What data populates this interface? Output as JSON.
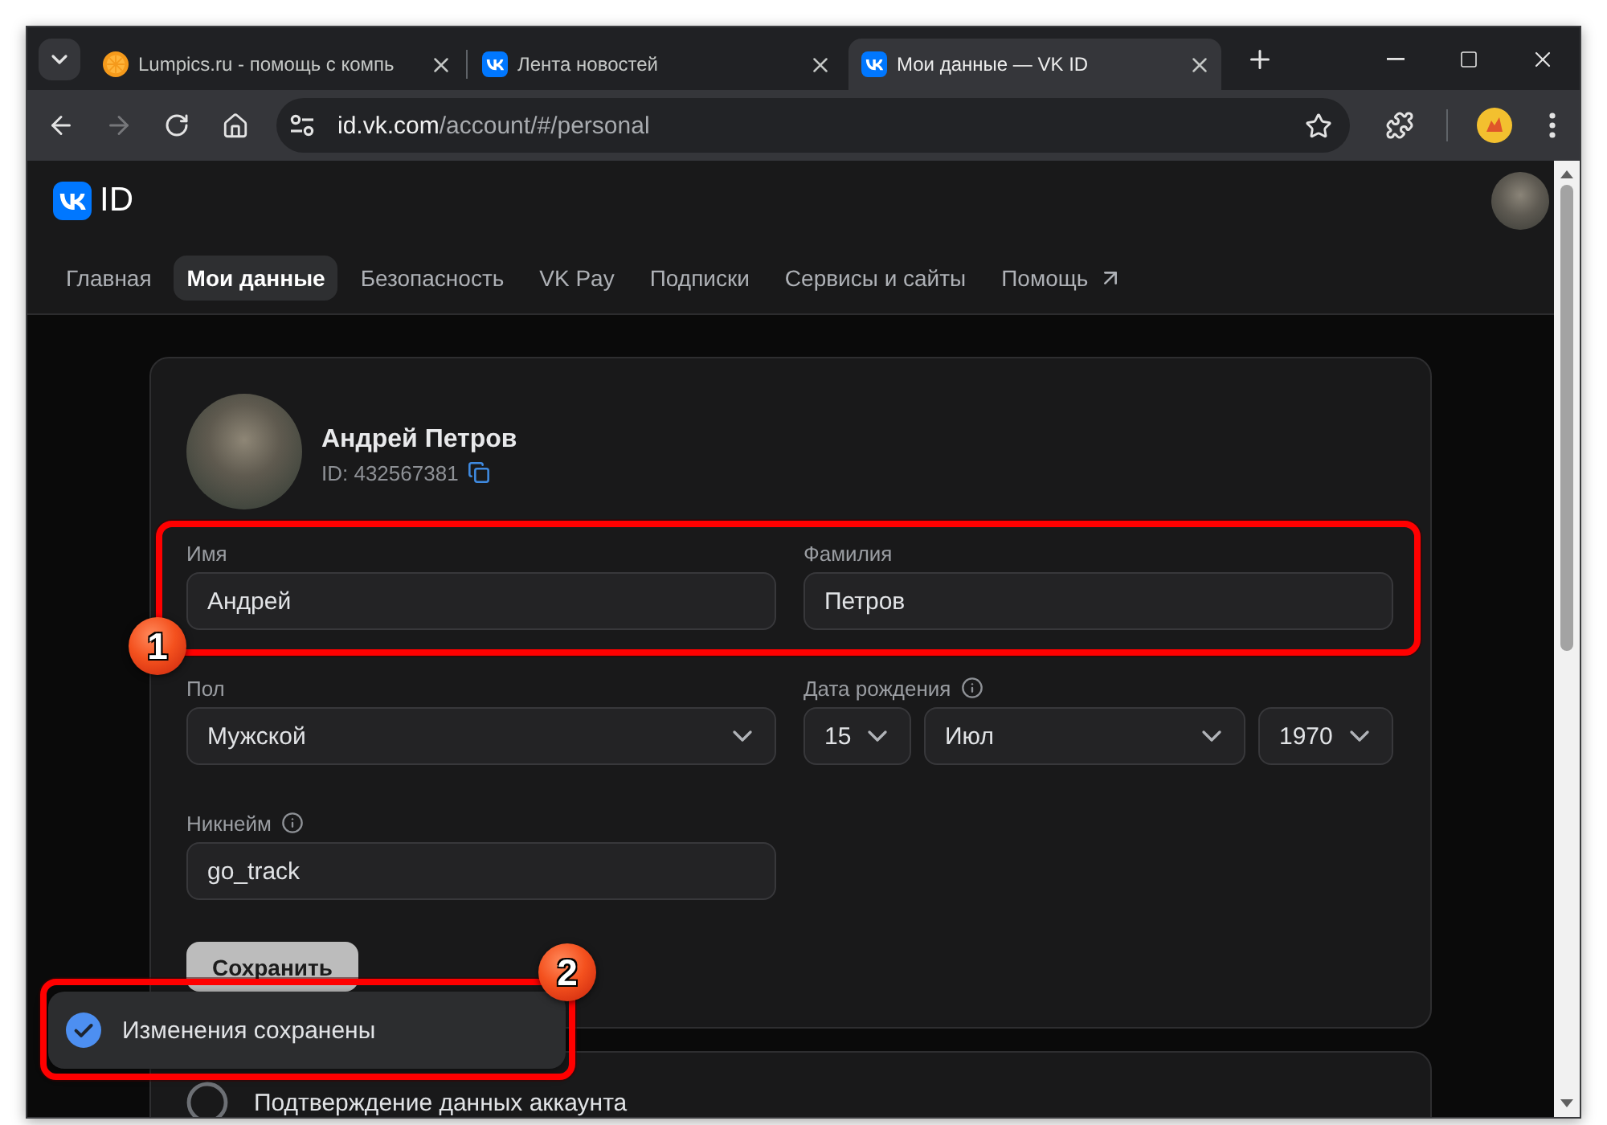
{
  "browser": {
    "tabs": [
      {
        "kind": "citrus",
        "title": "Lumpics.ru - помощь с компь",
        "selected": false
      },
      {
        "kind": "vk",
        "title": "Лента новостей",
        "selected": false
      },
      {
        "kind": "vk",
        "title": "Мои данные — VK ID",
        "selected": true
      }
    ],
    "nav_buttons": [
      {
        "kind": "back",
        "disabled": false
      },
      {
        "kind": "forward",
        "disabled": true
      },
      {
        "kind": "reload",
        "disabled": false
      },
      {
        "kind": "home",
        "disabled": false
      }
    ],
    "address": {
      "host": "id.vk.com",
      "path": "/account/#/personal"
    }
  },
  "site": {
    "logo_text": "ID",
    "nav": [
      {
        "label": "Главная",
        "selected": false
      },
      {
        "label": "Мои данные",
        "selected": true
      },
      {
        "label": "Безопасность",
        "selected": false
      },
      {
        "label": "VK Pay",
        "selected": false
      },
      {
        "label": "Подписки",
        "selected": false
      },
      {
        "label": "Сервисы и сайты",
        "selected": false
      },
      {
        "label": "Помощь",
        "selected": false,
        "external": true
      }
    ]
  },
  "profile": {
    "name": "Андрей Петров",
    "id_text": "ID: 432567381"
  },
  "form": {
    "rows": [
      {
        "callout": "1",
        "fields": [
          {
            "kind": "input",
            "label": "Имя",
            "value": "Андрей"
          },
          {
            "kind": "input",
            "label": "Фамилия",
            "value": "Петров"
          }
        ]
      },
      {
        "fields": [
          {
            "kind": "select",
            "label": "Пол",
            "value": "Мужской"
          },
          {
            "kind": "date",
            "label": "Дата рождения",
            "info": true,
            "parts": [
              "15",
              "Июл",
              "1970"
            ]
          }
        ]
      },
      {
        "fields": [
          {
            "kind": "input",
            "label": "Никнейм",
            "info": true,
            "value": "go_track"
          }
        ]
      }
    ],
    "save_button": "Сохранить"
  },
  "toast": {
    "text": "Изменения сохранены",
    "callout": "2"
  },
  "next_card": {
    "title": "Подтверждение данных аккаунта"
  }
}
